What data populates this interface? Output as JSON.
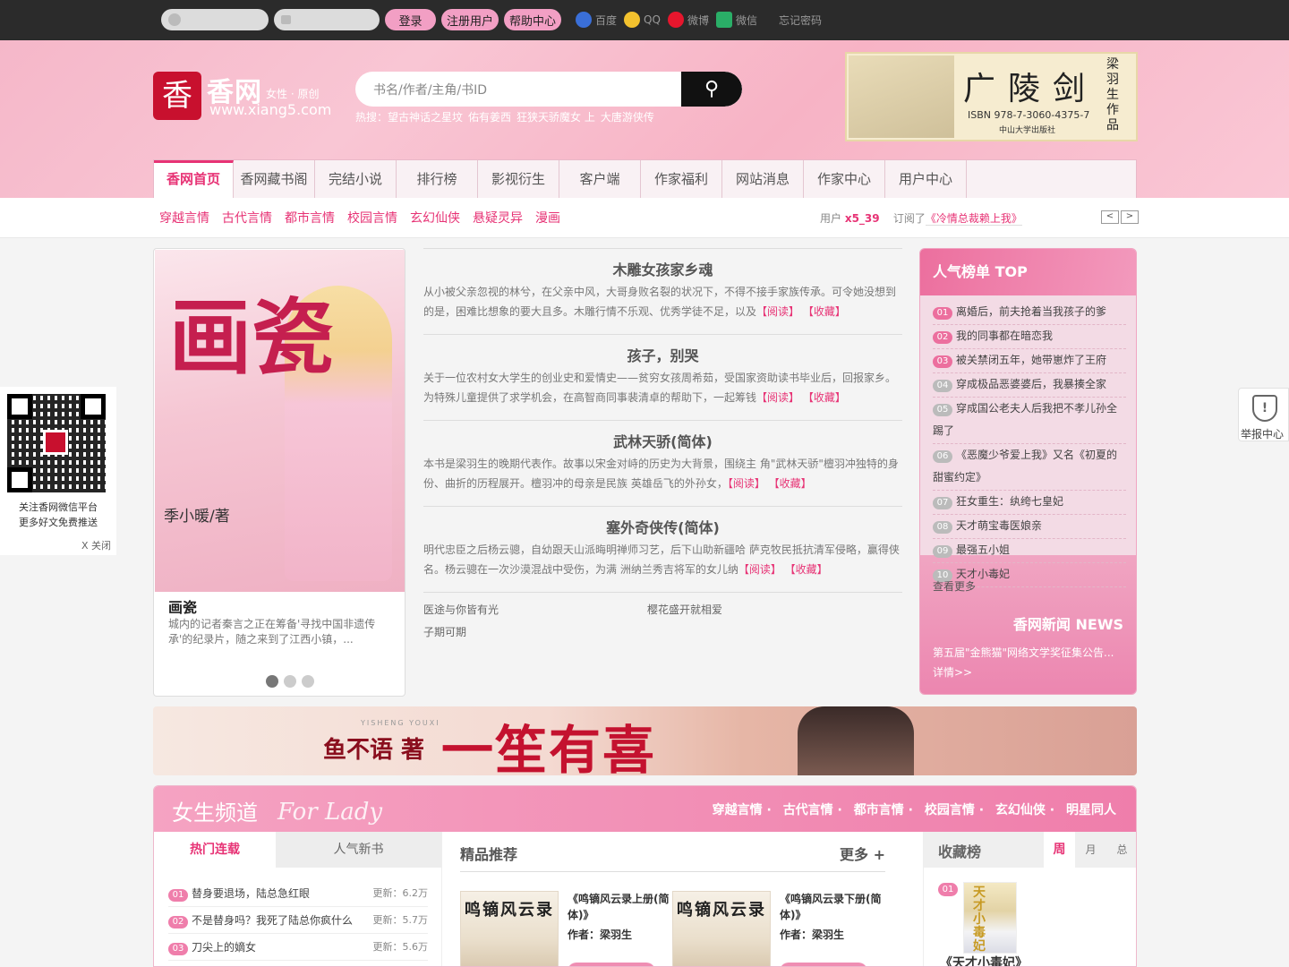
{
  "topbar": {
    "username_placeholder": "",
    "password_placeholder": "",
    "login": "登录",
    "register": "注册用户",
    "help": "帮助中心",
    "social": [
      "百度",
      "QQ",
      "微博",
      "微信"
    ],
    "forgot": "忘记密码"
  },
  "header": {
    "logo_glyph": "香",
    "logo_name": "香网",
    "logo_sub": "女性 · 原创",
    "logo_url": "www.xiang5.com",
    "search_placeholder": "书名/作者/主角/书ID",
    "hot_label": "热搜：",
    "hot": [
      "望古神话之星坟",
      "佑有姜西",
      "狂狭天骄魔女 上",
      "大唐游侠传"
    ],
    "ad": {
      "title": "广陵剑",
      "isbn": "ISBN 978-7-3060-4375-7",
      "publisher": "中山大学出版社",
      "author": "梁羽生作品"
    }
  },
  "nav": [
    "香网首页",
    "香网藏书阁",
    "完结小说",
    "排行榜",
    "影视衍生",
    "客户端",
    "作家福利",
    "网站消息",
    "作家中心",
    "用户中心"
  ],
  "subnav": {
    "cats": [
      "穿越言情",
      "古代言情",
      "都市言情",
      "校园言情",
      "玄幻仙侠",
      "悬疑灵异",
      "漫画"
    ],
    "feed_user_prefix": "用户",
    "feed_user": "x5_39",
    "feed_action": "订阅了",
    "feed_book": "《冷情总裁赖上我》",
    "prev": "<",
    "next": ">"
  },
  "feature": {
    "cover_title": "画瓷",
    "cover_author": "季小暖/著",
    "title": "画瓷",
    "desc": "城内的记者秦言之正在筹备'寻找中国非遗传承'的纪录片，随之来到了江西小镇，..."
  },
  "books": [
    {
      "title": "木雕女孩家乡魂",
      "desc": "从小被父亲忽视的林兮，在父亲中风，大哥身败名裂的状况下，不得不接手家族传承。可令她没想到的是，困难比想象的要大且多。木雕行情不乐观、优秀学徒不足，以及",
      "read": "【阅读】",
      "fav": "【收藏】"
    },
    {
      "title": "孩子，别哭",
      "desc": "关于一位农村女大学生的创业史和爱情史——贫穷女孩周希茹，受国家资助读书毕业后，回报家乡。为特殊儿童提供了求学机会，在高智商同事裴清卓的帮助下，一起筹钱",
      "read": "【阅读】",
      "fav": "【收藏】"
    },
    {
      "title": "武林天骄(简体)",
      "desc": "本书是梁羽生的晚期代表作。故事以宋金对峙的历史为大背景，围绕主 角\"武林天骄\"檀羽冲独特的身份、曲折的历程展开。檀羽冲的母亲是民族 英雄岳飞的外孙女，",
      "read": "【阅读】",
      "fav": "【收藏】"
    },
    {
      "title": "塞外奇侠传(简体)",
      "desc": "明代忠臣之后杨云骢，自幼跟天山派晦明禅师习艺，后下山助新疆哈 萨克牧民抵抗清军侵略，赢得侠名。杨云骢在一次沙漠混战中受伤，为满 洲纳兰秀吉将军的女儿纳",
      "read": "【阅读】",
      "fav": "【收藏】"
    }
  ],
  "extra_links": [
    "医途与你皆有光",
    "樱花盛开就相爱",
    "子期可期"
  ],
  "rank": {
    "title": "人气榜单 TOP",
    "items": [
      {
        "no": "01",
        "name": "离婚后，前夫抢着当我孩子的爹"
      },
      {
        "no": "02",
        "name": "我的同事都在暗恋我"
      },
      {
        "no": "03",
        "name": "被关禁闭五年，她带崽炸了王府"
      },
      {
        "no": "04",
        "name": "穿成极品恶婆婆后，我暴揍全家"
      },
      {
        "no": "05",
        "name": "穿成国公老夫人后我把不孝儿孙全踢了"
      },
      {
        "no": "06",
        "name": "《恶魔少爷爱上我》又名《初夏的甜蜜约定》"
      },
      {
        "no": "07",
        "name": "狂女重生：纨绔七皇妃"
      },
      {
        "no": "08",
        "name": "天才萌宝毒医娘亲"
      },
      {
        "no": "09",
        "name": "最强五小姐"
      },
      {
        "no": "10",
        "name": "天才小毒妃"
      }
    ],
    "more": "查看更多",
    "news_title": "香网新闻 NEWS",
    "news": "第五届\"金熊猫\"网络文学奖征集公告... 详情>>"
  },
  "banner": {
    "author": "鱼不语 著",
    "pinyin": "YISHENG YOUXI",
    "title": "一笙有喜"
  },
  "channel": {
    "title": "女生频道",
    "title_en": "For Lady",
    "cats": [
      "穿越言情",
      "古代言情",
      "都市言情",
      "校园言情",
      "玄幻仙侠",
      "明星同人"
    ],
    "tabs": [
      "热门连载",
      "人气新书"
    ],
    "list": [
      {
        "no": "01",
        "name": "替身要退场，陆总急红眼",
        "update": "更新：6.2万"
      },
      {
        "no": "02",
        "name": "不是替身吗？我死了陆总你疯什么",
        "update": "更新：5.7万"
      },
      {
        "no": "03",
        "name": "刀尖上的嫡女",
        "update": "更新：5.6万"
      }
    ],
    "picks_title": "精品推荐",
    "picks_more": "更多 +",
    "picks": [
      {
        "cover": "鸣镝风云录",
        "name": "《鸣镝风云录上册(简体)》",
        "author": "作者：梁羽生"
      },
      {
        "cover": "鸣镝风云录",
        "name": "《鸣镝风云录下册(简体)》",
        "author": "作者：梁羽生"
      }
    ],
    "fav_title": "收藏榜",
    "fav_tabs": [
      "周",
      "月",
      "总"
    ],
    "fav_item": {
      "no": "01",
      "cover": "天才小毒妃",
      "name": "《天才小毒妃》"
    }
  },
  "qr": {
    "line1": "关注香网微信平台",
    "line2": "更多好文免费推送",
    "close": "X 关闭"
  },
  "report": {
    "label": "举报中心",
    "glyph": "!"
  }
}
